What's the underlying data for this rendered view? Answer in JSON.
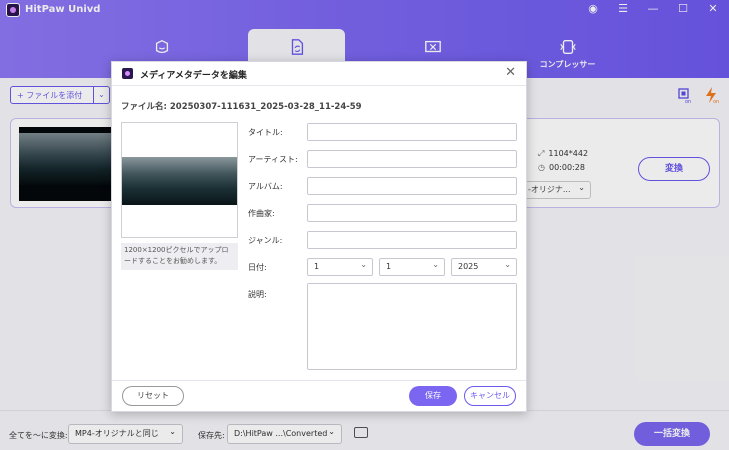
{
  "app": {
    "title": "HitPaw Univd"
  },
  "window_controls": [
    "user-icon",
    "menu-icon",
    "minimize-icon",
    "maximize-icon",
    "close-icon"
  ],
  "tabs": [
    {
      "icon": "face-icon",
      "label": ""
    },
    {
      "icon": "convert-icon",
      "label": "",
      "active": true
    },
    {
      "icon": "edit-icon",
      "label": ""
    },
    {
      "icon": "compress-icon",
      "label": "コンプレッサー"
    }
  ],
  "toolbar": {
    "add_file": "+ ファイルを添付"
  },
  "file_item": {
    "resolution": "1104*442",
    "duration": "00:00:28",
    "output_format": "-オリジナ...",
    "convert_label": "変換"
  },
  "bottom": {
    "convert_all_to_label": "全てを～に変換:",
    "format_value": "MP4-オリジナルと同じ",
    "save_to_label": "保存先:",
    "save_path": "D:\\HitPaw ...\\Converted",
    "convert_all_button": "一括変換"
  },
  "dialog": {
    "title": "メディアメタデータを編集",
    "filename": "ファイル名: 20250307-111631_2025-03-28_11-24-59",
    "hint": "1200×1200ピクセルでアップロードすることをお勧めします。",
    "fields": {
      "title_label": "タイトル:",
      "artist_label": "アーティスト:",
      "album_label": "アルバム:",
      "composer_label": "作曲家:",
      "genre_label": "ジャンル:",
      "date_label": "日付:",
      "description_label": "説明:"
    },
    "date": {
      "month": "1",
      "day": "1",
      "year": "2025"
    },
    "reset": "リセット",
    "save": "保存",
    "cancel": "キャンセル"
  },
  "colors": {
    "accent": "#7a66f0",
    "accent_dark": "#6a5aef"
  }
}
